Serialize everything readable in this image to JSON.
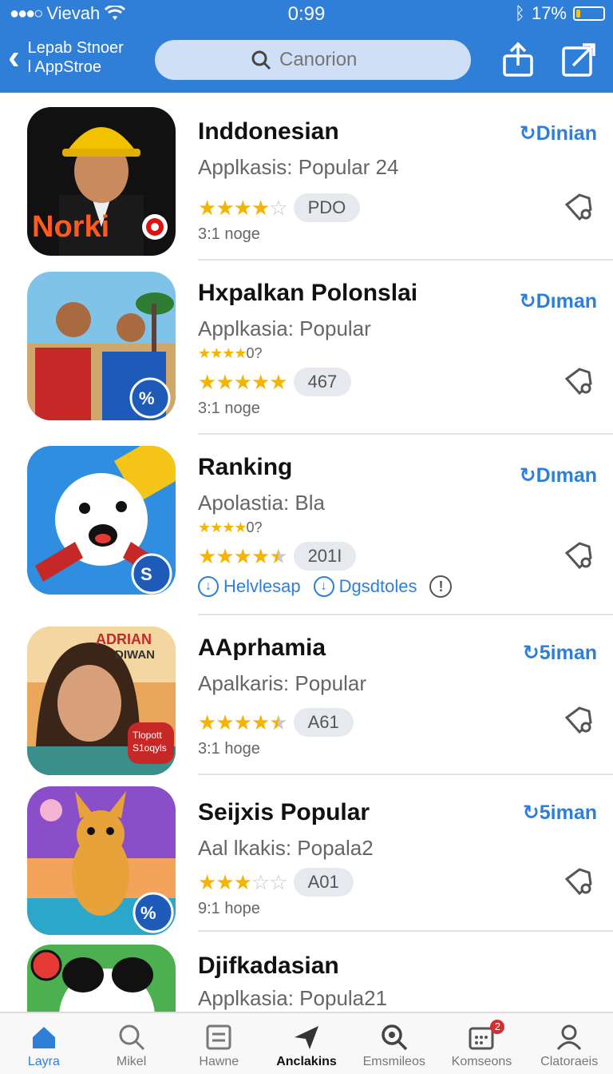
{
  "status": {
    "carrier": "Vievah",
    "time": "0:99",
    "battery_text": "17%",
    "battery_level": 0.17
  },
  "nav": {
    "back_line1": "Lepab Stnoer",
    "back_line2": "l AppStroe",
    "search_placeholder": "Canorion"
  },
  "apps": [
    {
      "name": "Inddonesian",
      "subtitle": "Applkasis: Popular 24",
      "get": "Dinian",
      "stars": 4,
      "pill": "PDO",
      "meta": "3:1 noge"
    },
    {
      "name": "Hxpalkan Polonslai",
      "subtitle": "Applkasia: Popular",
      "small_rating": "0?",
      "get": "Dıman",
      "stars": 5,
      "pill": "467",
      "meta": "3:1 noge"
    },
    {
      "name": "Ranking",
      "subtitle": "Apolastia: Bla",
      "small_rating": "0?",
      "get": "Dıman",
      "stars": 4.5,
      "pill": "201I",
      "link1": "Helvlesap",
      "link2": "Dgsdtoles"
    },
    {
      "name": "AAprhamia",
      "subtitle": "Apalkaris: Popular",
      "get": "5iman",
      "stars": 4.5,
      "pill": "A61",
      "meta": "3:1 hoge"
    },
    {
      "name": "Seijxis Popular",
      "subtitle": "Aal lkakis: Popala2",
      "get": "5iman",
      "stars": 3,
      "pill": "A01",
      "meta": "9:1 hope"
    },
    {
      "name": "Djifkadasian",
      "subtitle": "Applkasia: Popula21"
    }
  ],
  "thumb_text": {
    "app1_logo": "Norki",
    "app4_banner1": "ADRIAN",
    "app4_banner2": "DIWAN",
    "app4_tag1": "Tlopott",
    "app4_tag2": "S1oqyls"
  },
  "tabs": [
    {
      "label": "Layra",
      "icon": "home-icon"
    },
    {
      "label": "Mikel",
      "icon": "search-icon"
    },
    {
      "label": "Hawne",
      "icon": "document-icon"
    },
    {
      "label": "Anclakins",
      "icon": "send-icon"
    },
    {
      "label": "Emsmileos",
      "icon": "zoom-icon"
    },
    {
      "label": "Komseons",
      "icon": "calendar-icon",
      "badge": "2"
    },
    {
      "label": "Clatoraeis",
      "icon": "person-icon"
    }
  ],
  "colors": {
    "header": "#2f7fd8",
    "accent": "#2f7fd8",
    "star": "#f4b400"
  }
}
